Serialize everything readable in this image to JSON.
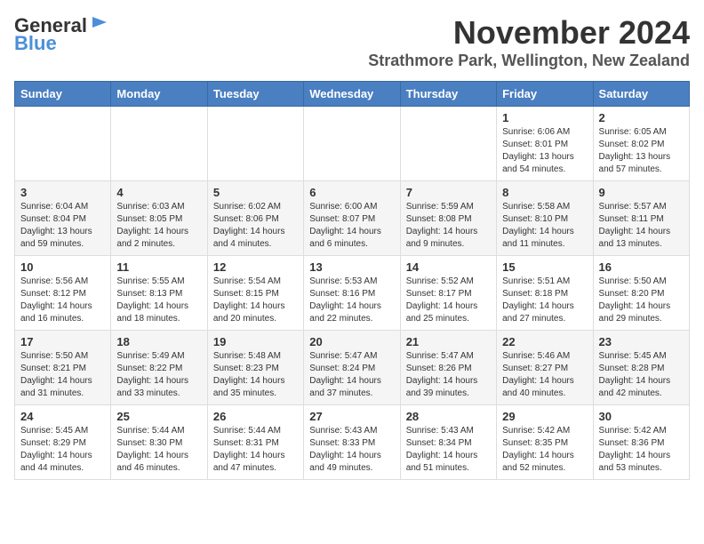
{
  "logo": {
    "text1": "General",
    "text2": "Blue"
  },
  "title": "November 2024",
  "subtitle": "Strathmore Park, Wellington, New Zealand",
  "headers": [
    "Sunday",
    "Monday",
    "Tuesday",
    "Wednesday",
    "Thursday",
    "Friday",
    "Saturday"
  ],
  "weeks": [
    [
      {
        "day": "",
        "info": ""
      },
      {
        "day": "",
        "info": ""
      },
      {
        "day": "",
        "info": ""
      },
      {
        "day": "",
        "info": ""
      },
      {
        "day": "",
        "info": ""
      },
      {
        "day": "1",
        "info": "Sunrise: 6:06 AM\nSunset: 8:01 PM\nDaylight: 13 hours and 54 minutes."
      },
      {
        "day": "2",
        "info": "Sunrise: 6:05 AM\nSunset: 8:02 PM\nDaylight: 13 hours and 57 minutes."
      }
    ],
    [
      {
        "day": "3",
        "info": "Sunrise: 6:04 AM\nSunset: 8:04 PM\nDaylight: 13 hours and 59 minutes."
      },
      {
        "day": "4",
        "info": "Sunrise: 6:03 AM\nSunset: 8:05 PM\nDaylight: 14 hours and 2 minutes."
      },
      {
        "day": "5",
        "info": "Sunrise: 6:02 AM\nSunset: 8:06 PM\nDaylight: 14 hours and 4 minutes."
      },
      {
        "day": "6",
        "info": "Sunrise: 6:00 AM\nSunset: 8:07 PM\nDaylight: 14 hours and 6 minutes."
      },
      {
        "day": "7",
        "info": "Sunrise: 5:59 AM\nSunset: 8:08 PM\nDaylight: 14 hours and 9 minutes."
      },
      {
        "day": "8",
        "info": "Sunrise: 5:58 AM\nSunset: 8:10 PM\nDaylight: 14 hours and 11 minutes."
      },
      {
        "day": "9",
        "info": "Sunrise: 5:57 AM\nSunset: 8:11 PM\nDaylight: 14 hours and 13 minutes."
      }
    ],
    [
      {
        "day": "10",
        "info": "Sunrise: 5:56 AM\nSunset: 8:12 PM\nDaylight: 14 hours and 16 minutes."
      },
      {
        "day": "11",
        "info": "Sunrise: 5:55 AM\nSunset: 8:13 PM\nDaylight: 14 hours and 18 minutes."
      },
      {
        "day": "12",
        "info": "Sunrise: 5:54 AM\nSunset: 8:15 PM\nDaylight: 14 hours and 20 minutes."
      },
      {
        "day": "13",
        "info": "Sunrise: 5:53 AM\nSunset: 8:16 PM\nDaylight: 14 hours and 22 minutes."
      },
      {
        "day": "14",
        "info": "Sunrise: 5:52 AM\nSunset: 8:17 PM\nDaylight: 14 hours and 25 minutes."
      },
      {
        "day": "15",
        "info": "Sunrise: 5:51 AM\nSunset: 8:18 PM\nDaylight: 14 hours and 27 minutes."
      },
      {
        "day": "16",
        "info": "Sunrise: 5:50 AM\nSunset: 8:20 PM\nDaylight: 14 hours and 29 minutes."
      }
    ],
    [
      {
        "day": "17",
        "info": "Sunrise: 5:50 AM\nSunset: 8:21 PM\nDaylight: 14 hours and 31 minutes."
      },
      {
        "day": "18",
        "info": "Sunrise: 5:49 AM\nSunset: 8:22 PM\nDaylight: 14 hours and 33 minutes."
      },
      {
        "day": "19",
        "info": "Sunrise: 5:48 AM\nSunset: 8:23 PM\nDaylight: 14 hours and 35 minutes."
      },
      {
        "day": "20",
        "info": "Sunrise: 5:47 AM\nSunset: 8:24 PM\nDaylight: 14 hours and 37 minutes."
      },
      {
        "day": "21",
        "info": "Sunrise: 5:47 AM\nSunset: 8:26 PM\nDaylight: 14 hours and 39 minutes."
      },
      {
        "day": "22",
        "info": "Sunrise: 5:46 AM\nSunset: 8:27 PM\nDaylight: 14 hours and 40 minutes."
      },
      {
        "day": "23",
        "info": "Sunrise: 5:45 AM\nSunset: 8:28 PM\nDaylight: 14 hours and 42 minutes."
      }
    ],
    [
      {
        "day": "24",
        "info": "Sunrise: 5:45 AM\nSunset: 8:29 PM\nDaylight: 14 hours and 44 minutes."
      },
      {
        "day": "25",
        "info": "Sunrise: 5:44 AM\nSunset: 8:30 PM\nDaylight: 14 hours and 46 minutes."
      },
      {
        "day": "26",
        "info": "Sunrise: 5:44 AM\nSunset: 8:31 PM\nDaylight: 14 hours and 47 minutes."
      },
      {
        "day": "27",
        "info": "Sunrise: 5:43 AM\nSunset: 8:33 PM\nDaylight: 14 hours and 49 minutes."
      },
      {
        "day": "28",
        "info": "Sunrise: 5:43 AM\nSunset: 8:34 PM\nDaylight: 14 hours and 51 minutes."
      },
      {
        "day": "29",
        "info": "Sunrise: 5:42 AM\nSunset: 8:35 PM\nDaylight: 14 hours and 52 minutes."
      },
      {
        "day": "30",
        "info": "Sunrise: 5:42 AM\nSunset: 8:36 PM\nDaylight: 14 hours and 53 minutes."
      }
    ]
  ]
}
